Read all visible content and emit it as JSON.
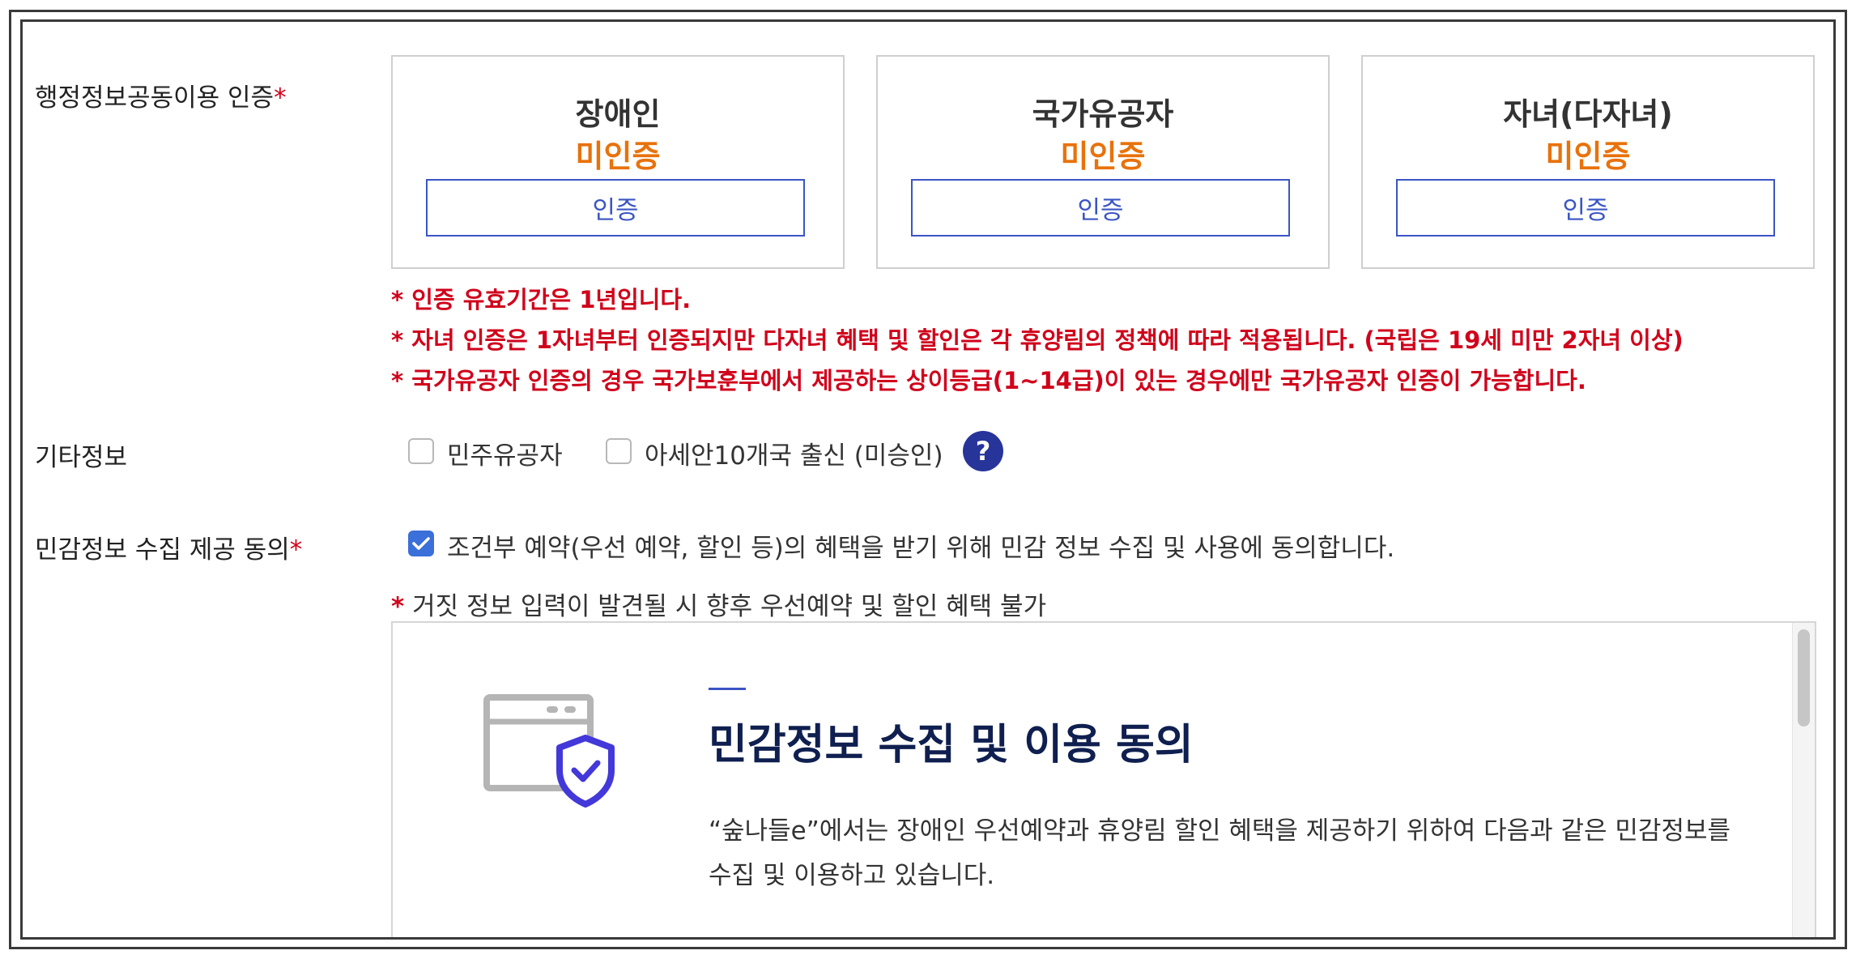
{
  "form": {
    "admin_info_label": "행정정보공동이용 인증",
    "required_mark": "*",
    "other_info_label": "기타정보",
    "sensitive_consent_label": "민감정보 수집 제공 동의"
  },
  "certifications": [
    {
      "title": "장애인",
      "status": "미인증",
      "button": "인증"
    },
    {
      "title": "국가유공자",
      "status": "미인증",
      "button": "인증"
    },
    {
      "title": "자녀(다자녀)",
      "status": "미인증",
      "button": "인증"
    }
  ],
  "notices": [
    "* 인증 유효기간은 1년입니다.",
    "* 자녀 인증은 1자녀부터 인증되지만 다자녀 혜택 및 할인은 각 휴양림의 정책에 따라 적용됩니다. (국립은 19세 미만 2자녀 이상)",
    "* 국가유공자 인증의 경우 국가보훈부에서 제공하는 상이등급(1~14급)이 있는 경우에만 국가유공자 인증이 가능합니다."
  ],
  "other_info": {
    "options": [
      {
        "label": "민주유공자",
        "checked": false
      },
      {
        "label": "아세안10개국 출신 (미승인)",
        "checked": false
      }
    ],
    "help_symbol": "?"
  },
  "consent": {
    "checkbox_label": "조건부 예약(우선 예약, 할인 등)의 혜택을 받기 위해 민감 정보 수집 및 사용에 동의합니다.",
    "checked": true,
    "false_info_star": "*",
    "false_info_text": " 거짓 정보 입력이 발견될 시 향후 우선예약 및 할인 혜택 불가",
    "panel_title": "민감정보 수집 및 이용 동의",
    "panel_description": "“숲나들e”에서는 장애인 우선예약과 휴양림 할인 혜택을 제공하기 위하여 다음과 같은 민감정보를 수집 및 이용하고 있습니다."
  },
  "colors": {
    "required": "#d0021b",
    "status_uncertified": "#e8720c",
    "button_blue": "#3b55c4",
    "help_badge": "#27349a",
    "checkbox_checked": "#3b6fd9",
    "panel_title": "#0f1f4f"
  }
}
